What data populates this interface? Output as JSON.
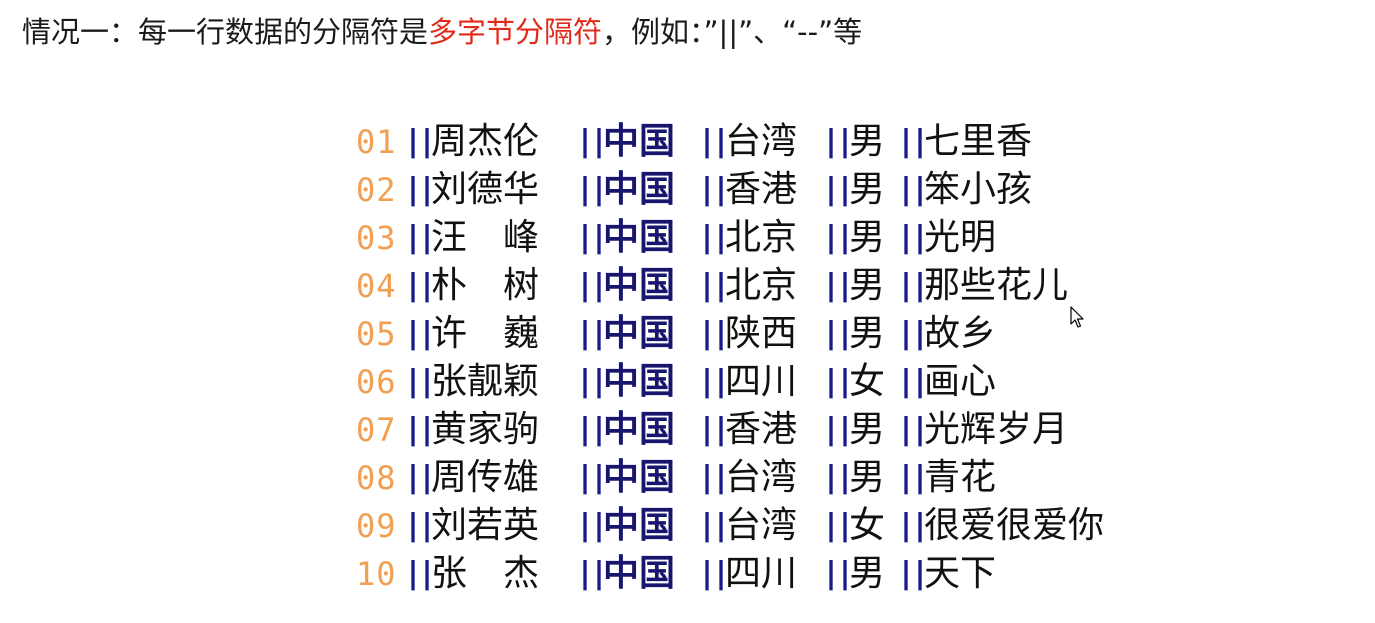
{
  "heading": {
    "prefix": "情况一：每一行数据的分隔符是",
    "highlight": "多字节分隔符",
    "suffix": "，例如：”||”、“--”等",
    "highlight_color": "#e02a1a"
  },
  "separator": "||",
  "colors": {
    "line_number": "#f0a050",
    "separator": "#1a1a8c",
    "text": "#111111"
  },
  "rows": [
    {
      "num": "01",
      "name": "周杰伦",
      "country": "中国",
      "region": "台湾",
      "gender": "男",
      "song": "七里香"
    },
    {
      "num": "02",
      "name": "刘德华",
      "country": "中国",
      "region": "香港",
      "gender": "男",
      "song": "笨小孩"
    },
    {
      "num": "03",
      "name": "汪　峰",
      "country": "中国",
      "region": "北京",
      "gender": "男",
      "song": "光明"
    },
    {
      "num": "04",
      "name": "朴　树",
      "country": "中国",
      "region": "北京",
      "gender": "男",
      "song": "那些花儿"
    },
    {
      "num": "05",
      "name": "许　巍",
      "country": "中国",
      "region": "陕西",
      "gender": "男",
      "song": "故乡"
    },
    {
      "num": "06",
      "name": "张靓颖",
      "country": "中国",
      "region": "四川",
      "gender": "女",
      "song": "画心"
    },
    {
      "num": "07",
      "name": "黄家驹",
      "country": "中国",
      "region": "香港",
      "gender": "男",
      "song": "光辉岁月"
    },
    {
      "num": "08",
      "name": "周传雄",
      "country": "中国",
      "region": "台湾",
      "gender": "男",
      "song": "青花"
    },
    {
      "num": "09",
      "name": "刘若英",
      "country": "中国",
      "region": "台湾",
      "gender": "女",
      "song": "很爱很爱你"
    },
    {
      "num": "10",
      "name": "张　杰",
      "country": "中国",
      "region": "四川",
      "gender": "男",
      "song": "天下"
    }
  ]
}
